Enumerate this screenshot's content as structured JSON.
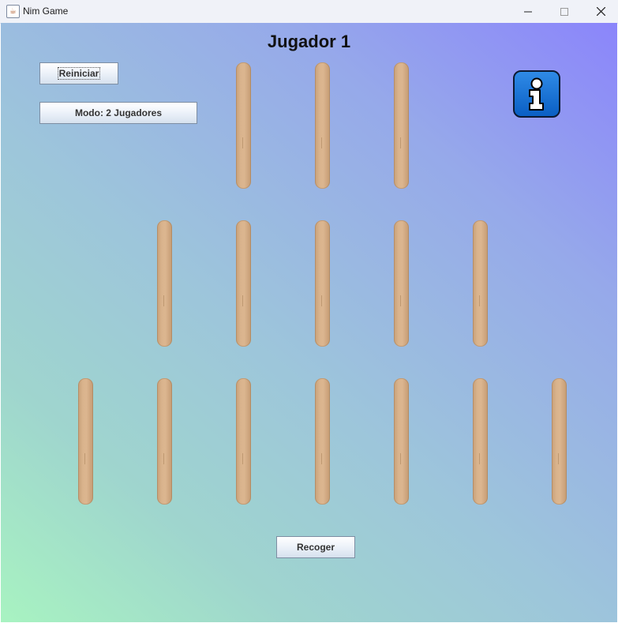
{
  "window": {
    "title": "Nim Game",
    "app_icon": "java-cup-icon",
    "minimize_symbol": "—",
    "maximize_symbol": "☐",
    "close_symbol": "✕"
  },
  "game": {
    "current_player": "Jugador 1",
    "rows": [
      3,
      5,
      7
    ],
    "stick_color": "#d7b088"
  },
  "controls": {
    "restart_label": "Reiniciar",
    "mode_label": "Modo: 2 Jugadores",
    "collect_label": "Recoger",
    "info_icon": "info-icon"
  }
}
